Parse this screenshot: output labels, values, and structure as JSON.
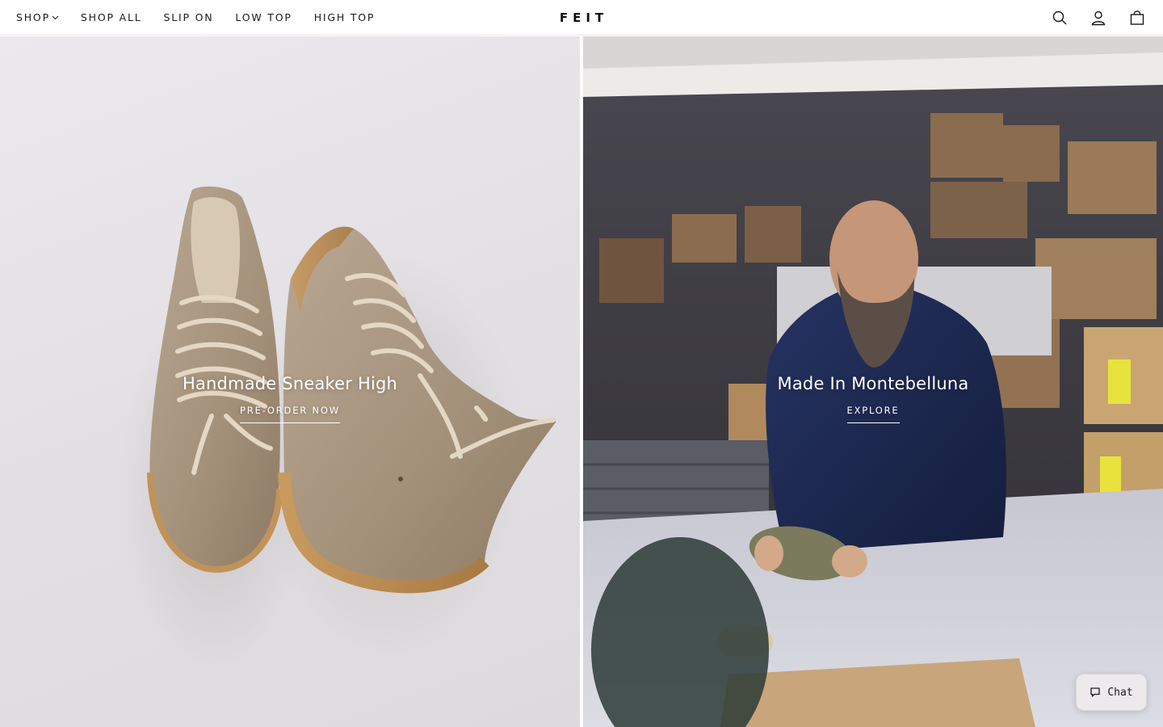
{
  "brand": {
    "logo_text": "FEIT"
  },
  "nav": {
    "items": [
      {
        "label": "SHOP",
        "has_dropdown": true
      },
      {
        "label": "SHOP ALL"
      },
      {
        "label": "SLIP ON"
      },
      {
        "label": "LOW TOP"
      },
      {
        "label": "HIGH TOP"
      }
    ]
  },
  "header_icons": [
    "search-icon",
    "account-icon",
    "bag-icon"
  ],
  "hero": {
    "left": {
      "title": "Handmade Sneaker High",
      "cta": "PRE-ORDER NOW"
    },
    "right": {
      "title": "Made In Montebelluna",
      "cta": "EXPLORE"
    }
  },
  "chat": {
    "label": "Chat",
    "icon": "chat-bubble-icon"
  },
  "colors": {
    "text": "#1a1a1a",
    "background": "#ffffff",
    "caption": "#ffffff"
  }
}
